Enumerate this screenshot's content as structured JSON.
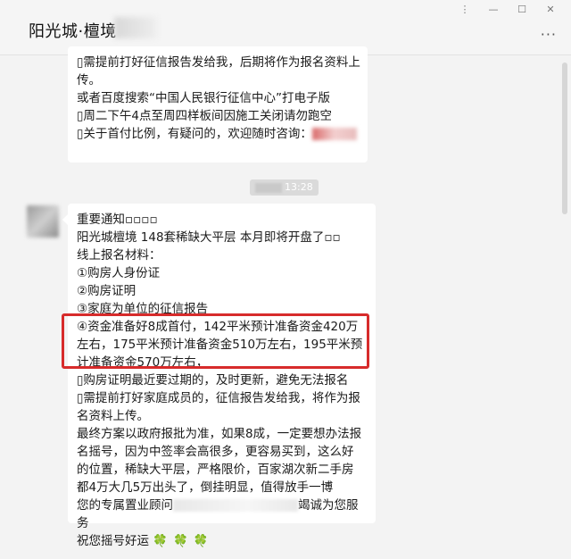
{
  "window": {
    "title": "阳光城·檀境",
    "controls": [
      "⋮",
      "—",
      "☐",
      "✕"
    ],
    "more_icon": "···"
  },
  "messages": [
    {
      "lines": [
        "▯需提前打好征信报告发给我，后期将作为报名资料上",
        "传。",
        "或者百度搜索“中国人民银行征信中心”打电子版",
        "▯周二下午4点至周四样板间因施工关闭请勿跑空",
        "▯关于首付比例，有疑问的，欢迎随时咨询："
      ]
    },
    {
      "timestamp": "13:28",
      "lines": [
        "重要通知▫▫▫▫",
        "阳光城檀境 148套稀缺大平层  本月即将开盘了▫▫",
        "线上报名材料：",
        "①购房人身份证",
        "②购房证明",
        "③家庭为单位的征信报告",
        "④资金准备好8成首付，142平米预计准备资金420万",
        "左右，175平米预计准备资金510万左右，195平米预",
        "计准备资金570万左右，",
        "▯购房证明最近要过期的，及时更新，避免无法报名",
        "▯需提前打好家庭成员的，征信报告发给我，将作为报",
        "名资料上传。",
        "最终方案以政府报批为准，如果8成，一定要想办法报",
        "名摇号，因为中签率会高很多，更容易买到，这么好",
        "的位置，稀缺大平层，严格限价，百家湖次新二手房",
        "都4万大几5万出头了，倒挂明显，值得放手一博",
        "您的专属置业顾问",
        "竭诚为您服",
        "务",
        "祝您摇号好运"
      ],
      "emoji": "🍀🍀🍀"
    }
  ]
}
